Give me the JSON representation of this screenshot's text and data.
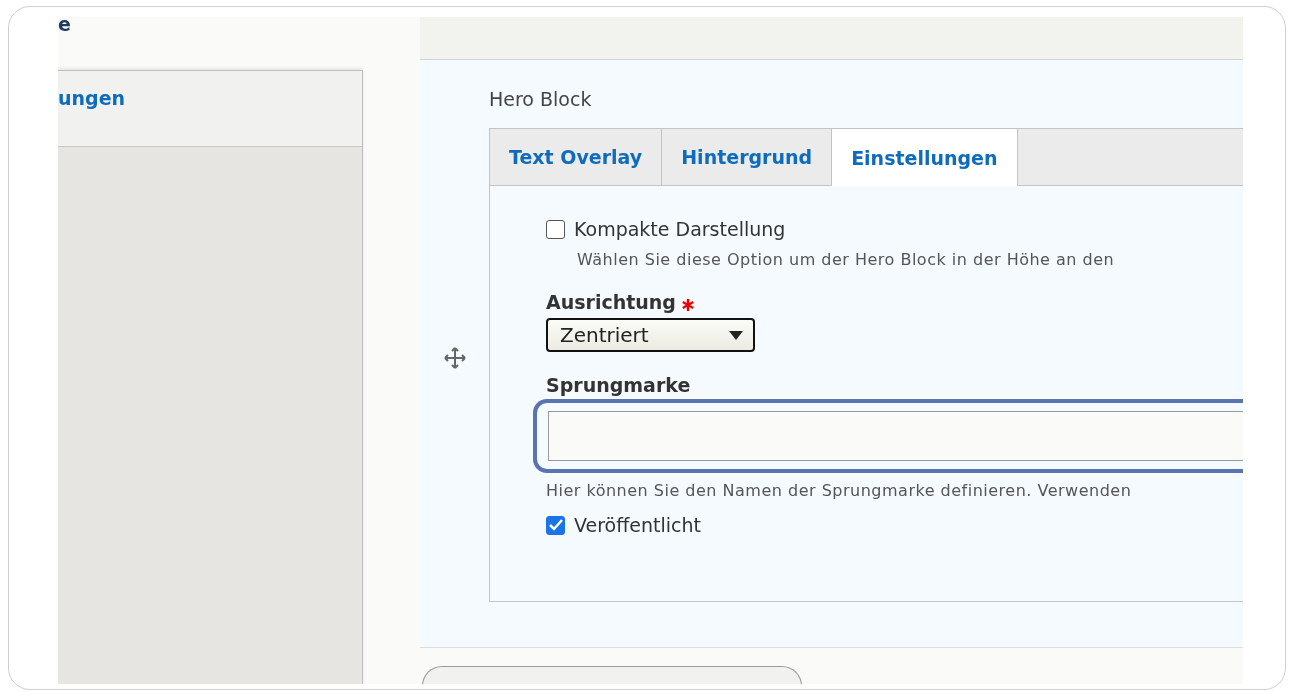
{
  "sidebar": {
    "heading": "e",
    "link": "ungen"
  },
  "paragraph": {
    "title": "Hero Block",
    "tabs": [
      {
        "label": "Text Overlay",
        "selected": false
      },
      {
        "label": "Hintergrund",
        "selected": false
      },
      {
        "label": "Einstellungen",
        "selected": true
      }
    ],
    "fields": [
      {
        "kind": "checkbox",
        "label": "Kompakte Darstellung",
        "checked": false,
        "description": "Wählen Sie diese Option um der Hero Block in der Höhe an den"
      },
      {
        "kind": "select",
        "label": "Ausrichtung",
        "required": true,
        "value": "Zentriert"
      },
      {
        "kind": "text",
        "label": "Sprungmarke",
        "focused": true,
        "description": "Hier können Sie den Namen der Sprungmarke definieren. Verwenden"
      },
      {
        "kind": "checkbox",
        "label": "Veröffentlicht",
        "checked": true
      }
    ]
  }
}
